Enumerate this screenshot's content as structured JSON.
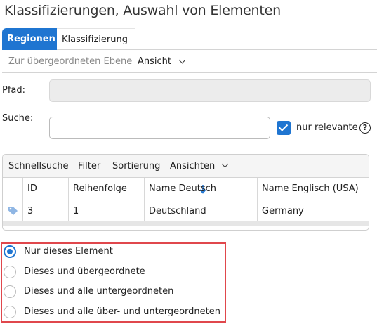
{
  "window": {
    "title": "Klassifizierungen, Auswahl von Elementen"
  },
  "tabs": [
    {
      "label": "Regionen",
      "active": true
    },
    {
      "label": "Klassifizierung",
      "active": false
    }
  ],
  "toolbar": {
    "up_label": "Zur übergeordneten Ebene",
    "view_label": "Ansicht"
  },
  "form": {
    "path_label": "Pfad:",
    "path_value": "",
    "search_label": "Suche:",
    "search_value": "",
    "relevant_label": "nur relevante",
    "relevant_checked": true,
    "help_glyph": "?"
  },
  "grid": {
    "toolbar": [
      "Schnellsuche",
      "Filter",
      "Sortierung",
      "Ansichten"
    ],
    "columns": [
      "ID",
      "Reihenfolge",
      "Name Deutsch",
      "Name Englisch (USA)"
    ],
    "rows": [
      {
        "id": "3",
        "order": "1",
        "name_de": "Deutschland",
        "name_en": "Germany",
        "icon": "tag-icon"
      }
    ]
  },
  "options": [
    {
      "label": "Nur dieses Element",
      "checked": true
    },
    {
      "label": "Dieses und übergeordnete",
      "checked": false
    },
    {
      "label": "Dieses und alle untergeordneten",
      "checked": false
    },
    {
      "label": "Dieses und alle über- und untergeordneten",
      "checked": false
    }
  ],
  "colors": {
    "accent": "#1f75d1",
    "highlight_border": "#e0474c"
  }
}
